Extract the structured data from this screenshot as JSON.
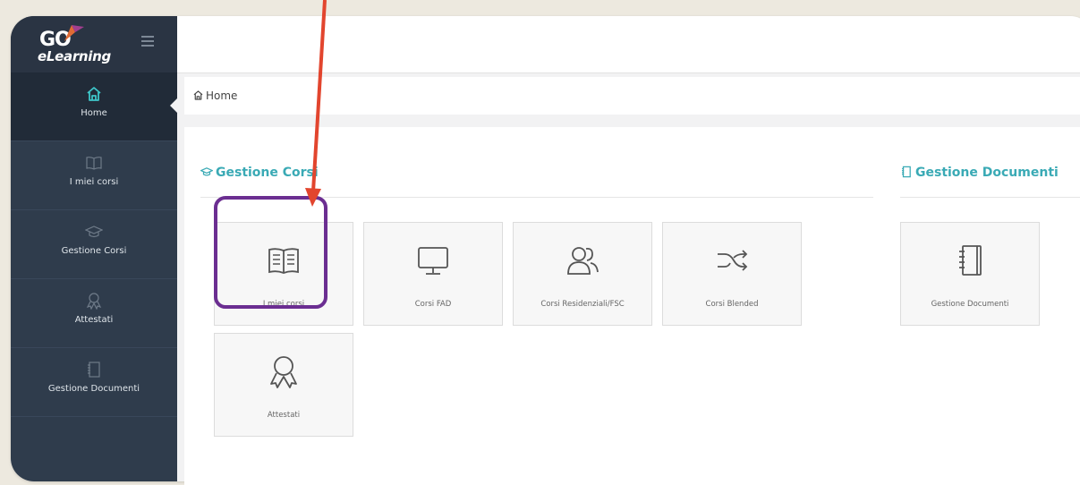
{
  "logo": {
    "brand": "GO",
    "tagline": "eLearning"
  },
  "sidebar": {
    "items": [
      {
        "label": "Home",
        "icon": "home-icon",
        "active": true
      },
      {
        "label": "I miei corsi",
        "icon": "book-icon"
      },
      {
        "label": "Gestione Corsi",
        "icon": "graduation-cap-icon"
      },
      {
        "label": "Attestati",
        "icon": "award-icon"
      },
      {
        "label": "Gestione Documenti",
        "icon": "notebook-icon"
      }
    ]
  },
  "breadcrumb": {
    "label": "Home"
  },
  "sections": {
    "corsi": {
      "title": "Gestione Corsi",
      "tiles": [
        {
          "label": "I miei corsi",
          "icon": "book-icon"
        },
        {
          "label": "Corsi FAD",
          "icon": "monitor-icon"
        },
        {
          "label": "Corsi Residenziali/FSC",
          "icon": "users-icon"
        },
        {
          "label": "Corsi Blended",
          "icon": "shuffle-icon"
        },
        {
          "label": "Attestati",
          "icon": "award-icon"
        }
      ]
    },
    "documenti": {
      "title": "Gestione Documenti",
      "tiles": [
        {
          "label": "Gestione Documenti",
          "icon": "notebook-icon"
        }
      ]
    }
  },
  "colors": {
    "sidebar": "#2f3c4c",
    "accent": "#3aaab5",
    "highlight": "#6b2e91",
    "arrow": "#e2452e"
  }
}
